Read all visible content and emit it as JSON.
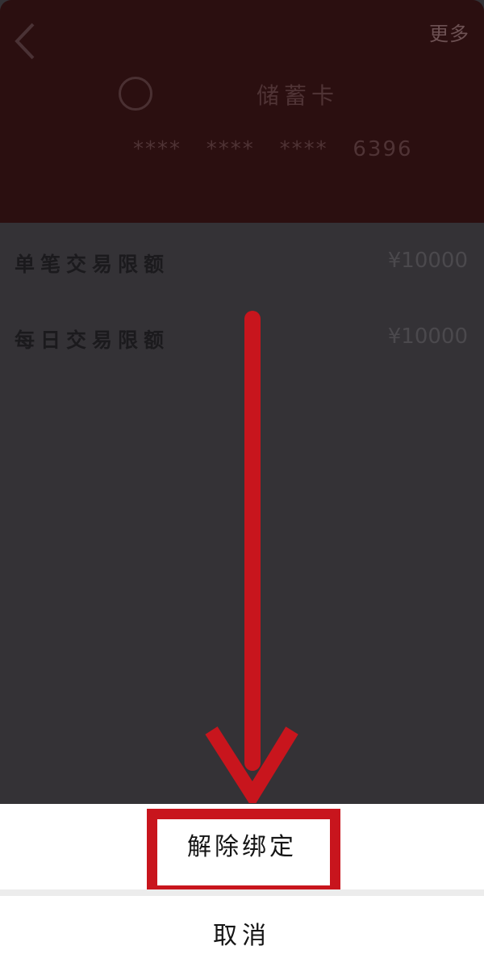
{
  "header": {
    "back_icon": "chevron-left-icon",
    "more_label": "更多",
    "card_name": "储蓄卡",
    "card_number": "****   ****   ****   6396"
  },
  "limits": [
    {
      "label": "单笔交易限额",
      "value": "¥10000"
    },
    {
      "label": "每日交易限额",
      "value": "¥10000"
    }
  ],
  "sheet": {
    "unbind_label": "解除绑定",
    "cancel_label": "取消"
  },
  "colors": {
    "header_bg": "#2b0f10",
    "overlay_bg": "#343236",
    "annotation_red": "#c8151d"
  }
}
